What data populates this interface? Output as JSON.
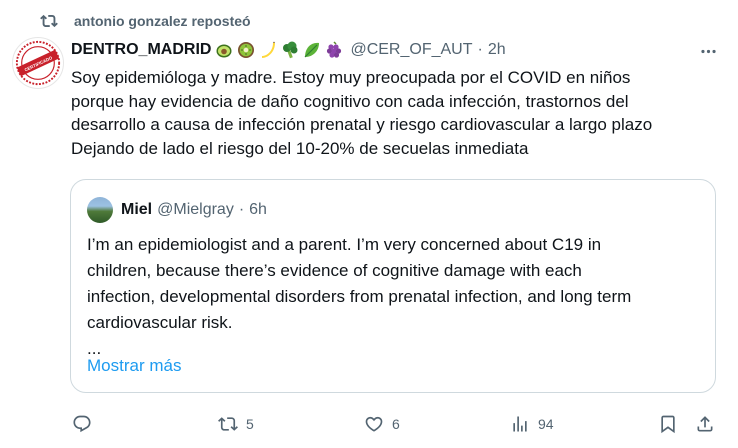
{
  "repost": {
    "icon": "repost-icon",
    "text": "antonio gonzalez reposteó"
  },
  "tweet": {
    "author_name": "DENTRO_MADRID",
    "emojis": [
      "avocado",
      "kiwi",
      "banana",
      "broccoli",
      "leafy-green",
      "grapes"
    ],
    "handle": "@CER_OF_AUT",
    "separator": "·",
    "time": "2h",
    "avatar_text": "CERTIFICADO DE AUTENTICIDAD",
    "text_lines": [
      "Soy epidemióloga y madre. Estoy muy preocupada por el COVID en niños",
      "porque hay evidencia de daño cognitivo con cada infección, trastornos del",
      "desarrollo a causa de infección prenatal y riesgo cardiovascular a largo plazo",
      "Dejando de lado el riesgo del 10-20% de secuelas inmediata"
    ]
  },
  "quote": {
    "author_name": "Miel",
    "handle": "@Mielgray",
    "separator": "·",
    "time": "6h",
    "text_lines": [
      "I’m an epidemiologist and a parent. I’m very concerned about C19 in",
      "children, because there’s evidence of cognitive damage with each",
      "infection, developmental disorders from prenatal infection, and long term",
      "cardiovascular risk.",
      "..."
    ],
    "show_more": "Mostrar más"
  },
  "actions": {
    "reply": {
      "icon": "reply-icon",
      "count": ""
    },
    "repost": {
      "icon": "repost-icon",
      "count": "5"
    },
    "like": {
      "icon": "heart-icon",
      "count": "6"
    },
    "views": {
      "icon": "views-icon",
      "count": "94"
    },
    "bookmark": {
      "icon": "bookmark-icon"
    },
    "share": {
      "icon": "share-icon"
    }
  },
  "colors": {
    "text": "#0f1419",
    "secondary": "#536471",
    "link": "#1d9bf0",
    "border": "#cfd9de",
    "repost_active": "#00ba7c"
  }
}
